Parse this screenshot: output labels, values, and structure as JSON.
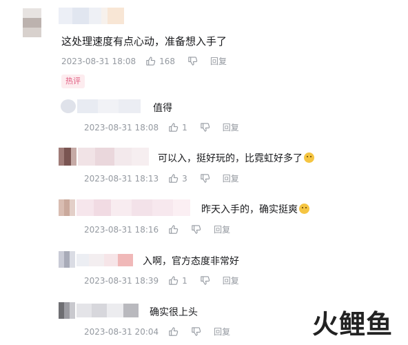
{
  "comments": [
    {
      "text": "这处理速度有点心动，准备想入手了",
      "time": "2023-08-31 18:08",
      "likes": "168",
      "reply": "回复",
      "badge": "热评"
    },
    {
      "text": "值得",
      "time": "2023-08-31 18:08",
      "likes": "1",
      "reply": "回复"
    },
    {
      "text": "可以入，挺好玩的，比霓虹好多了",
      "time": "2023-08-31 18:13",
      "likes": "3",
      "reply": "回复"
    },
    {
      "text": "昨天入手的，确实挺爽",
      "time": "2023-08-31 18:16",
      "likes": "",
      "reply": "回复"
    },
    {
      "text": "入啊，官方态度非常好",
      "time": "2023-08-31 18:39",
      "likes": "1",
      "reply": "回复"
    },
    {
      "text": "确实很上头",
      "time": "2023-08-31 20:04",
      "likes": "",
      "reply": "回复"
    }
  ],
  "watermark": "火鲤鱼",
  "colors": {
    "meta": "#9499a0",
    "badge_bg": "#fdecef",
    "badge_text": "#e05b80",
    "logo": "#e61e1e"
  },
  "icons": {
    "like": "thumbs-up-icon",
    "dislike": "thumbs-down-icon",
    "emoji": "emoji-icon"
  }
}
